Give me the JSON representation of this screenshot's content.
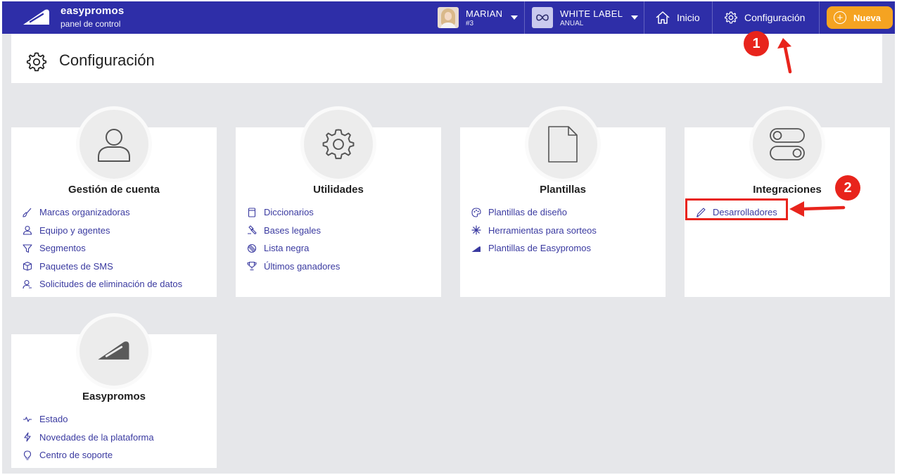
{
  "brand": {
    "name": "easypromos",
    "subtitle": "panel de control"
  },
  "topbar": {
    "user": {
      "name": "MARIAN",
      "id": "#3"
    },
    "plan": {
      "name": "WHITE LABEL",
      "period": "ANUAL",
      "icon": "infinity-icon"
    },
    "home_label": "Inicio",
    "settings_label": "Configuración",
    "new_label": "Nueva"
  },
  "page": {
    "title": "Configuración"
  },
  "cards": [
    {
      "title": "Gestión de cuenta",
      "icon": "user-icon",
      "links": [
        {
          "label": "Marcas organizadoras",
          "icon": "brush-icon"
        },
        {
          "label": "Equipo y agentes",
          "icon": "user-icon"
        },
        {
          "label": "Segmentos",
          "icon": "filter-icon"
        },
        {
          "label": "Paquetes de SMS",
          "icon": "box-icon"
        },
        {
          "label": "Solicitudes de eliminación de datos",
          "icon": "user-minus-icon"
        }
      ]
    },
    {
      "title": "Utilidades",
      "icon": "gear-icon",
      "links": [
        {
          "label": "Diccionarios",
          "icon": "book-icon"
        },
        {
          "label": "Bases legales",
          "icon": "gavel-icon"
        },
        {
          "label": "Lista negra",
          "icon": "ban-icon"
        },
        {
          "label": "Últimos ganadores",
          "icon": "trophy-icon"
        }
      ]
    },
    {
      "title": "Plantillas",
      "icon": "document-icon",
      "links": [
        {
          "label": "Plantillas de diseño",
          "icon": "palette-icon"
        },
        {
          "label": "Herramientas para sorteos",
          "icon": "sparkle-icon"
        },
        {
          "label": "Plantillas de Easypromos",
          "icon": "easypromos-logo-icon"
        }
      ]
    },
    {
      "title": "Integraciones",
      "icon": "toggles-icon",
      "links": [
        {
          "label": "Desarrolladores",
          "icon": "pen-icon"
        }
      ]
    },
    {
      "title": "Easypromos",
      "icon": "easypromos-logo-icon",
      "links": [
        {
          "label": "Estado",
          "icon": "pulse-icon"
        },
        {
          "label": "Novedades de la plataforma",
          "icon": "bolt-icon"
        },
        {
          "label": "Centro de soporte",
          "icon": "lightbulb-icon"
        }
      ]
    }
  ],
  "annotations": [
    {
      "number": "1"
    },
    {
      "number": "2"
    }
  ],
  "colors": {
    "topbar": "#2e2ea8",
    "accent": "#f5a321",
    "link": "#3a3aa0",
    "annotation": "#e8241c",
    "background": "#e6e7ea"
  }
}
